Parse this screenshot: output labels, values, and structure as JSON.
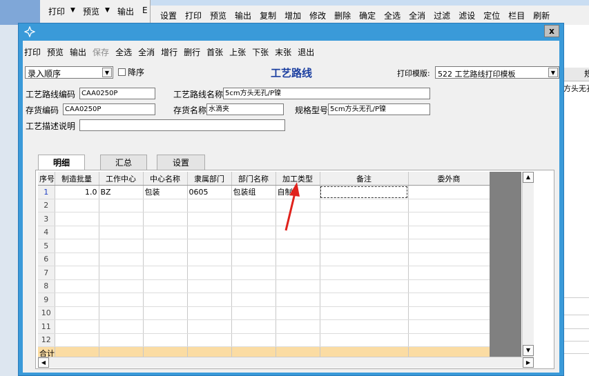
{
  "background": {
    "toolbar1": [
      "打印",
      "▼",
      "预览",
      "▼",
      "输出",
      "E"
    ],
    "toolbar2": [
      "设置",
      "打印",
      "预览",
      "输出",
      "复制",
      "增加",
      "修改",
      "删除",
      "确定",
      "全选",
      "全消",
      "过滤",
      "滤设",
      "定位",
      "栏目",
      "刷新"
    ],
    "right_col_header": "规",
    "right_cell": "方头无孔"
  },
  "dialog": {
    "icon": "app-icon",
    "close_label": "x"
  },
  "toolbar": [
    {
      "label": "打印",
      "enabled": true
    },
    {
      "label": "预览",
      "enabled": true
    },
    {
      "label": "输出",
      "enabled": true
    },
    {
      "label": "保存",
      "enabled": false
    },
    {
      "label": "全选",
      "enabled": true
    },
    {
      "label": "全消",
      "enabled": true
    },
    {
      "label": "增行",
      "enabled": true
    },
    {
      "label": "删行",
      "enabled": true
    },
    {
      "label": "首张",
      "enabled": true
    },
    {
      "label": "上张",
      "enabled": true
    },
    {
      "label": "下张",
      "enabled": true
    },
    {
      "label": "末张",
      "enabled": true
    },
    {
      "label": "退出",
      "enabled": true
    }
  ],
  "header": {
    "order_select": "录入顺序",
    "desc_label": "降序",
    "title": "工艺路线",
    "print_template_label": "打印模版:",
    "print_template_value": "522 工艺路线打印模板"
  },
  "form": {
    "route_code_label": "工艺路线编码",
    "route_code": "CAA0250P",
    "route_name_label": "工艺路线名称",
    "route_name": "5cm方头无孔/P镍",
    "inv_code_label": "存货编码",
    "inv_code": "CAA0250P",
    "inv_name_label": "存货名称",
    "inv_name": "水滴夹",
    "spec_label": "规格型号",
    "spec": "5cm方头无孔/P镍",
    "desc_label": "工艺描述说明",
    "desc": ""
  },
  "tabs": [
    "明细",
    "汇总",
    "设置"
  ],
  "grid": {
    "columns": [
      "序号",
      "制造批量",
      "工作中心",
      "中心名称",
      "隶属部门",
      "部门名称",
      "加工类型",
      "备注",
      "委外商"
    ],
    "rows": [
      [
        "1",
        "1.0",
        "BZ",
        "包装",
        "0605",
        "包装组",
        "自制",
        "",
        ""
      ],
      [
        "2",
        "",
        "",
        "",
        "",
        "",
        "",
        "",
        ""
      ],
      [
        "3",
        "",
        "",
        "",
        "",
        "",
        "",
        "",
        ""
      ],
      [
        "4",
        "",
        "",
        "",
        "",
        "",
        "",
        "",
        ""
      ],
      [
        "5",
        "",
        "",
        "",
        "",
        "",
        "",
        "",
        ""
      ],
      [
        "6",
        "",
        "",
        "",
        "",
        "",
        "",
        "",
        ""
      ],
      [
        "7",
        "",
        "",
        "",
        "",
        "",
        "",
        "",
        ""
      ],
      [
        "8",
        "",
        "",
        "",
        "",
        "",
        "",
        "",
        ""
      ],
      [
        "9",
        "",
        "",
        "",
        "",
        "",
        "",
        "",
        ""
      ],
      [
        "10",
        "",
        "",
        "",
        "",
        "",
        "",
        "",
        ""
      ],
      [
        "11",
        "",
        "",
        "",
        "",
        "",
        "",
        "",
        ""
      ],
      [
        "12",
        "",
        "",
        "",
        "",
        "",
        "",
        "",
        ""
      ]
    ],
    "total_label": "合计"
  },
  "annotation": {
    "color": "#e0221c"
  }
}
